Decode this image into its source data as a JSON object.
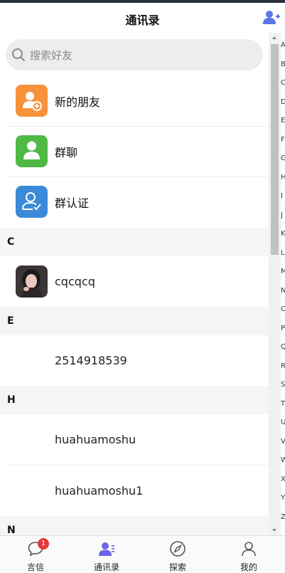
{
  "header": {
    "title": "通讯录",
    "add_icon": "add-contact-icon"
  },
  "search": {
    "placeholder": "搜索好友",
    "icon": "search-icon"
  },
  "features": [
    {
      "label": "新的朋友",
      "icon": "new-friend-icon",
      "color": "#f7923b"
    },
    {
      "label": "群聊",
      "icon": "group-chat-icon",
      "color": "#4fb946"
    },
    {
      "label": "群认证",
      "icon": "group-verify-icon",
      "color": "#3a8ad8"
    }
  ],
  "sections": [
    {
      "letter": "C",
      "contacts": [
        {
          "name": "cqcqcq",
          "has_avatar": true
        }
      ]
    },
    {
      "letter": "E",
      "contacts": [
        {
          "name": "2514918539",
          "has_avatar": false
        }
      ]
    },
    {
      "letter": "H",
      "contacts": [
        {
          "name": "huahuamoshu",
          "has_avatar": false
        },
        {
          "name": "huahuamoshu1",
          "has_avatar": false
        }
      ]
    },
    {
      "letter": "N",
      "contacts": []
    }
  ],
  "index_letters": [
    "A",
    "B",
    "C",
    "D",
    "E",
    "F",
    "G",
    "H",
    "I",
    "J",
    "K",
    "L",
    "M",
    "N",
    "O",
    "P",
    "Q",
    "R",
    "S",
    "T",
    "U",
    "V",
    "W",
    "X",
    "Y",
    "Z"
  ],
  "tabs": [
    {
      "label": "言信",
      "icon": "chat-bubble-icon",
      "badge": "1"
    },
    {
      "label": "通讯录",
      "icon": "contacts-icon",
      "active": true
    },
    {
      "label": "探索",
      "icon": "compass-icon"
    },
    {
      "label": "我的",
      "icon": "profile-icon"
    }
  ],
  "colors": {
    "accent": "#6c63e6",
    "badge": "#e5393a"
  }
}
